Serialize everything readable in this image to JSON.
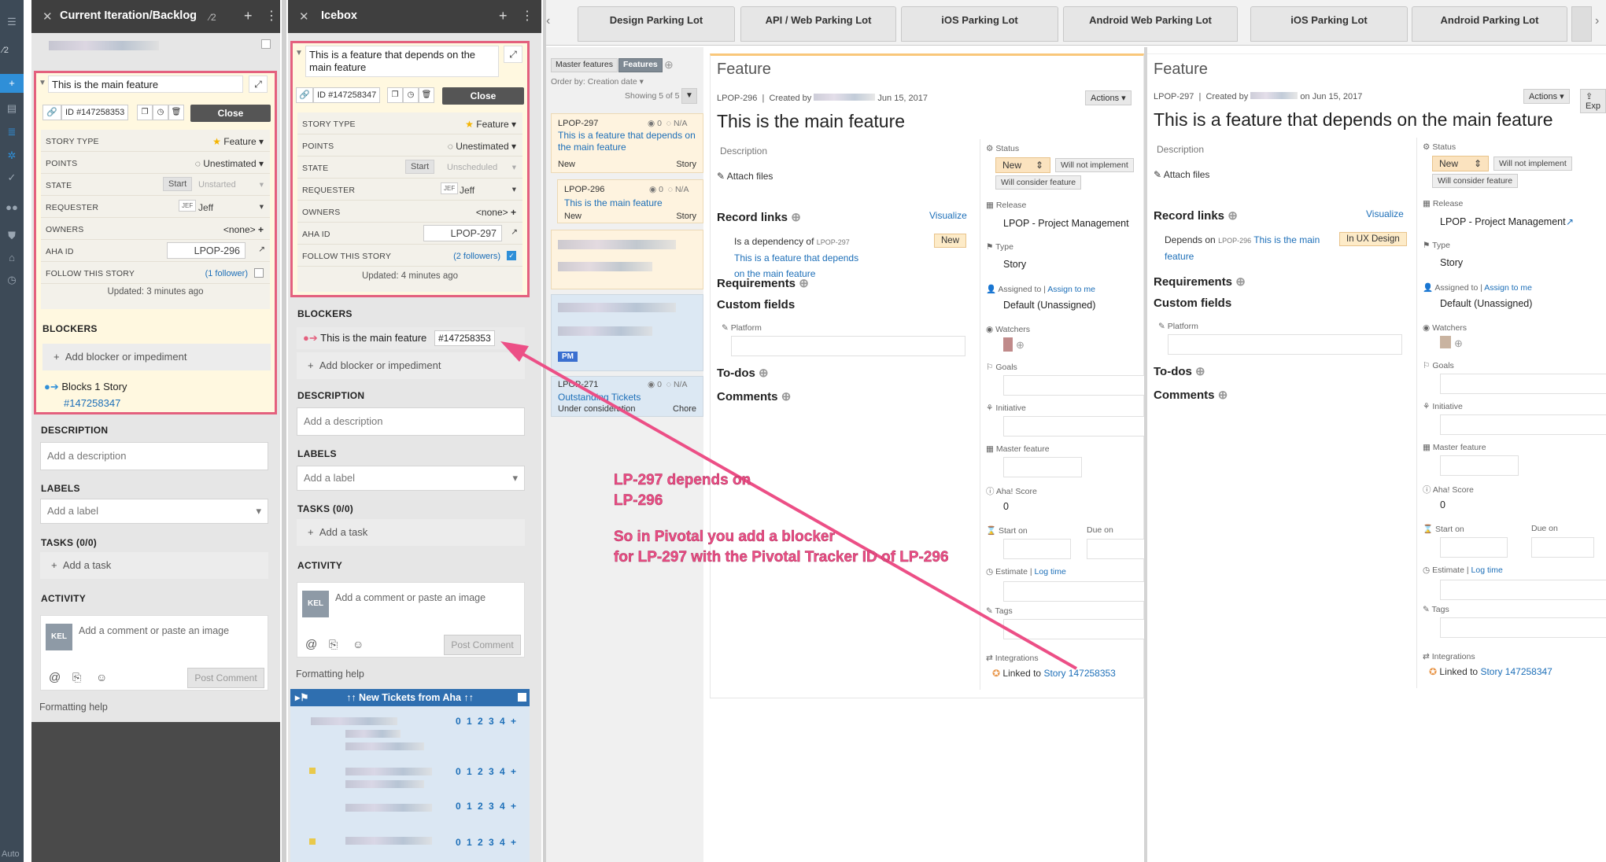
{
  "pivotal": {
    "rail": {
      "count_label": "2",
      "footer": "Auto"
    },
    "left_panel": {
      "title": "Current Iteration/Backlog",
      "count": "2",
      "story": {
        "title": "This is the main feature",
        "id_label": "ID",
        "id": "#147258353",
        "close_label": "Close",
        "fields": [
          {
            "label": "STORY TYPE",
            "value": "Feature"
          },
          {
            "label": "POINTS",
            "value": "Unestimated"
          },
          {
            "label": "STATE",
            "value": "Start",
            "value2": "Unstarted"
          },
          {
            "label": "REQUESTER",
            "value": "Jeff",
            "initials": "JEF"
          },
          {
            "label": "OWNERS",
            "value": "<none>"
          },
          {
            "label": "AHA ID",
            "value": "LPOP-296"
          },
          {
            "label": "FOLLOW THIS STORY",
            "value": "(1 follower)"
          }
        ],
        "updated": "Updated: 3 minutes ago"
      },
      "blockers_title": "BLOCKERS",
      "add_blocker": "Add blocker or impediment",
      "blocks_label": "Blocks 1 Story",
      "blocks_id": "#147258347",
      "description_title": "DESCRIPTION",
      "description_placeholder": "Add a description",
      "labels_title": "LABELS",
      "labels_placeholder": "Add a label",
      "tasks_title": "TASKS (0/0)",
      "add_task": "Add a task",
      "activity_title": "ACTIVITY",
      "avatar_initials": "KEL",
      "comment_placeholder": "Add a comment or paste an image",
      "post_comment": "Post Comment",
      "formatting_help": "Formatting help"
    },
    "right_panel": {
      "title": "Icebox",
      "story": {
        "title": "This is a feature that depends on the main feature",
        "id_label": "ID",
        "id": "#147258347",
        "close_label": "Close",
        "fields": [
          {
            "label": "STORY TYPE",
            "value": "Feature"
          },
          {
            "label": "POINTS",
            "value": "Unestimated"
          },
          {
            "label": "STATE",
            "value": "Start",
            "value2": "Unscheduled"
          },
          {
            "label": "REQUESTER",
            "value": "Jeff",
            "initials": "JEF"
          },
          {
            "label": "OWNERS",
            "value": "<none>"
          },
          {
            "label": "AHA ID",
            "value": "LPOP-297"
          },
          {
            "label": "FOLLOW THIS STORY",
            "value": "(2 followers)"
          }
        ],
        "updated": "Updated: 4 minutes ago"
      },
      "blockers_title": "BLOCKERS",
      "blocker_item": "This is the main feature",
      "blocker_id": "#147258353",
      "add_blocker": "Add blocker or impediment",
      "description_title": "DESCRIPTION",
      "description_placeholder": "Add a description",
      "labels_title": "LABELS",
      "labels_placeholder": "Add a label",
      "tasks_title": "TASKS (0/0)",
      "add_task": "Add a task",
      "activity_title": "ACTIVITY",
      "avatar_initials": "KEL",
      "comment_placeholder": "Add a comment or paste an image",
      "post_comment": "Post Comment",
      "formatting_help": "Formatting help",
      "epic_bar": "↑↑ New Tickets from Aha ↑↑",
      "points_scale": "0 1 2 3 4 +"
    }
  },
  "aha": {
    "tabs": [
      "Design Parking Lot",
      "API / Web Parking Lot",
      "iOS Parking Lot",
      "Android Web Parking Lot",
      "iOS Parking Lot",
      "Android Parking Lot"
    ],
    "list": {
      "toggle_master": "Master features",
      "toggle_features": "Features",
      "order_by_label": "Order by:",
      "order_by_value": "Creation date",
      "showing": "Showing 5 of 5",
      "cards": [
        {
          "ref": "LPOP-297",
          "count": "0",
          "na": "N/A",
          "title": "This is a feature that depends on the main feature",
          "status": "New",
          "type": "Story"
        },
        {
          "ref": "LPOP-296",
          "count": "0",
          "na": "N/A",
          "title": "This is the main feature",
          "status": "New",
          "type": "Story"
        },
        {
          "ref": "LPOP-271",
          "count": "0",
          "na": "N/A",
          "title": "Outstanding Tickets",
          "status": "Under consideration",
          "type": "Chore"
        }
      ],
      "pm_badge": "PM"
    },
    "detail_left": {
      "kind": "Feature",
      "ref": "LPOP-296",
      "created_by": "Created by",
      "created_on": "Jun 15, 2017",
      "actions": "Actions",
      "title": "This is the main feature",
      "description": "Description",
      "attach": "Attach files",
      "record_links": "Record links",
      "visualize": "Visualize",
      "link_relation": "Is a dependency of",
      "link_ref": "LPOP-297",
      "link_title": "This is a feature that depends on the main feature",
      "link_status": "New",
      "requirements": "Requirements",
      "custom_fields": "Custom fields",
      "platform": "Platform",
      "todos": "To-dos",
      "comments": "Comments",
      "status_label": "Status",
      "status_value": "New",
      "will_not": "Will not implement",
      "will_consider": "Will consider feature",
      "release_label": "Release",
      "release_value": "LPOP - Project Management",
      "type_label": "Type",
      "type_value": "Story",
      "assigned_label": "Assigned to",
      "assign_me": "Assign to me",
      "assigned_value": "Default (Unassigned)",
      "watchers": "Watchers",
      "goals": "Goals",
      "initiative": "Initiative",
      "master_feature": "Master feature",
      "score_label": "Aha! Score",
      "score_value": "0",
      "start_on": "Start on",
      "due_on": "Due on",
      "estimate": "Estimate",
      "log_time": "Log time",
      "tags": "Tags",
      "integrations": "Integrations",
      "linked_to": "Linked to",
      "linked_story": "Story 147258353"
    },
    "detail_right": {
      "kind": "Feature",
      "ref": "LPOP-297",
      "created_by": "Created by",
      "created_on": "on Jun 15, 2017",
      "actions": "Actions",
      "export": "Exp",
      "title": "This is a feature that depends on the main feature",
      "description": "Description",
      "attach": "Attach files",
      "record_links": "Record links",
      "visualize": "Visualize",
      "link_relation": "Depends on",
      "link_ref": "LPOP-296",
      "link_title": "This is the main feature",
      "link_status": "In UX Design",
      "requirements": "Requirements",
      "custom_fields": "Custom fields",
      "platform": "Platform",
      "todos": "To-dos",
      "comments": "Comments",
      "status_label": "Status",
      "status_value": "New",
      "will_not": "Will not implement",
      "will_consider": "Will consider feature",
      "release_label": "Release",
      "release_value": "LPOP - Project Management",
      "type_label": "Type",
      "type_value": "Story",
      "assigned_label": "Assigned to",
      "assign_me": "Assign to me",
      "assigned_value": "Default (Unassigned)",
      "watchers": "Watchers",
      "goals": "Goals",
      "initiative": "Initiative",
      "master_feature": "Master feature",
      "score_label": "Aha! Score",
      "score_value": "0",
      "start_on": "Start on",
      "due_on": "Due on",
      "estimate": "Estimate",
      "log_time": "Log time",
      "tags": "Tags",
      "integrations": "Integrations",
      "linked_to": "Linked to",
      "linked_story": "Story 147258347"
    }
  },
  "annotation": {
    "line1": "LP-297 depends on",
    "line2": "LP-296",
    "line3": "So in Pivotal you add a blocker",
    "line4": "for LP-297 with the Pivotal Tracker ID of LP-296"
  },
  "colors": {
    "accent": "#e4607e",
    "annotation": "#ec4f86",
    "link": "#1d6fb8",
    "pivotal_blue": "#2f8fd8"
  }
}
